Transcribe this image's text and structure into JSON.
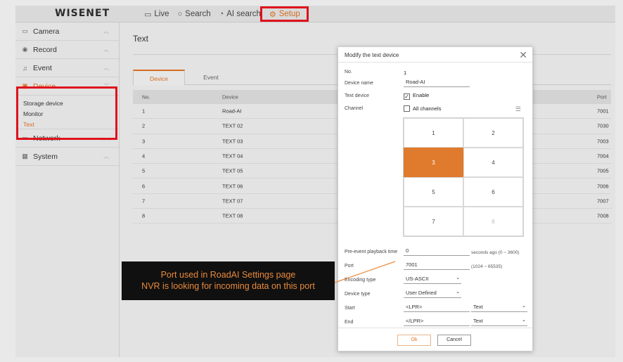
{
  "app": {
    "logo": "WISENET"
  },
  "nav": [
    {
      "label": "Live",
      "icon": "monitor-icon"
    },
    {
      "label": "Search",
      "icon": "search-icon"
    },
    {
      "label": "AI search",
      "icon": "ai-search-icon"
    },
    {
      "label": "Setup",
      "icon": "gear-icon",
      "active": true
    }
  ],
  "sidebar": {
    "items": [
      {
        "label": "Camera",
        "icon": "camera-icon"
      },
      {
        "label": "Record",
        "icon": "record-icon"
      },
      {
        "label": "Event",
        "icon": "bell-icon"
      },
      {
        "label": "Device",
        "icon": "device-icon",
        "active": true
      },
      {
        "label": "Network",
        "icon": "network-icon"
      },
      {
        "label": "System",
        "icon": "system-icon"
      }
    ],
    "device_sub": [
      "Storage device",
      "Monitor",
      "Text"
    ]
  },
  "page": {
    "title": "Text",
    "tabs": [
      "Device",
      "Event"
    ],
    "table": {
      "headers": {
        "no": "No.",
        "device": "Device",
        "port": "Port"
      },
      "rows": [
        {
          "no": "1",
          "device": "Road-AI",
          "port": "7001"
        },
        {
          "no": "2",
          "device": "TEXT 02",
          "port": "7030"
        },
        {
          "no": "3",
          "device": "TEXT 03",
          "port": "7003"
        },
        {
          "no": "4",
          "device": "TEXT 04",
          "port": "7004"
        },
        {
          "no": "5",
          "device": "TEXT 05",
          "port": "7005"
        },
        {
          "no": "6",
          "device": "TEXT 06",
          "port": "7006"
        },
        {
          "no": "7",
          "device": "TEXT 07",
          "port": "7007"
        },
        {
          "no": "8",
          "device": "TEXT 08",
          "port": "7008"
        }
      ]
    }
  },
  "modal": {
    "title": "Modify the text device",
    "no_label": "No.",
    "no_value": "1",
    "device_name_label": "Device name",
    "device_name_value": "Road-AI",
    "text_device_label": "Text device",
    "enable_label": "Enable",
    "channel_label": "Channel",
    "all_channels_label": "All channels",
    "channels": [
      "1",
      "2",
      "3",
      "4",
      "5",
      "6",
      "7",
      "8"
    ],
    "selected_channel": "3",
    "pre_event_label": "Pre-event playback time",
    "pre_event_value": "0",
    "pre_event_note": "seconds ago (0 ~ 3600)",
    "port_label": "Port",
    "port_value": "7001",
    "port_note": "(1024 ~ 65535)",
    "encoding_label": "Encoding type",
    "encoding_value": "US-ASCII",
    "device_type_label": "Device type",
    "device_type_value": "User Defined",
    "start_label": "Start",
    "start_value": "<LPR>",
    "start_type": "Text",
    "end_label": "End",
    "end_value": "</LPR>",
    "end_type": "Text",
    "ok_label": "Ok",
    "cancel_label": "Cancel"
  },
  "annotation": {
    "line1": "Port used in RoadAI Settings page",
    "line2": "NVR is looking for incoming data on this port",
    "color": "#e98a3c"
  },
  "colors": {
    "accent": "#e07020",
    "highlight": "#e8101a"
  }
}
